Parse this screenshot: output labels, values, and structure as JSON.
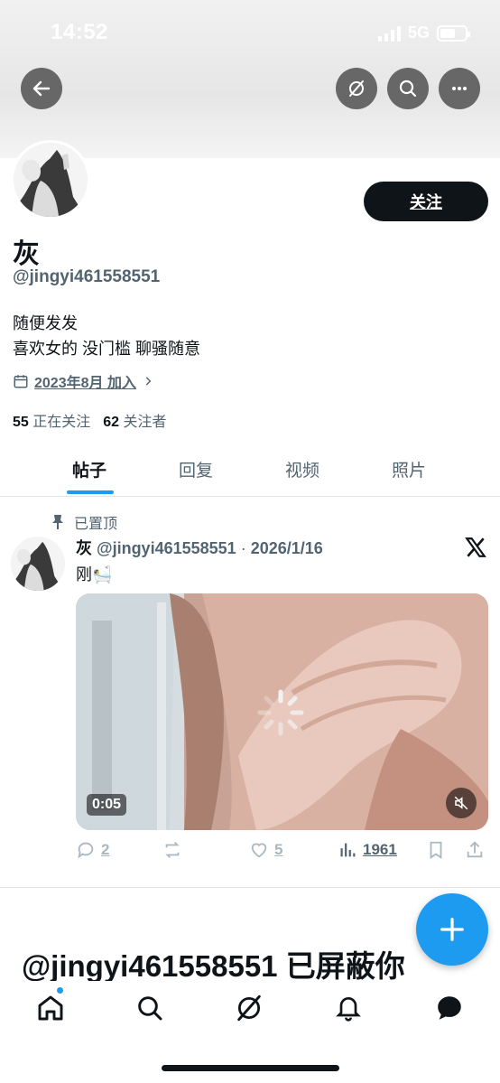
{
  "status_bar": {
    "time": "14:52",
    "network": "5G"
  },
  "header": {
    "icons": [
      "back-arrow-icon",
      "grok-icon",
      "search-icon",
      "more-icon"
    ]
  },
  "profile": {
    "display_name": "灰",
    "handle": "@jingyi461558551",
    "follow_label": "关注",
    "bio_lines": [
      "随便发发",
      "喜欢女的 没门槛 聊骚随意"
    ],
    "joined": "2023年8月 加入",
    "following_count": "55",
    "following_label": "正在关注",
    "followers_count": "62",
    "followers_label": "关注者"
  },
  "tabs": [
    {
      "label": "帖子",
      "active": true
    },
    {
      "label": "回复",
      "active": false
    },
    {
      "label": "视频",
      "active": false
    },
    {
      "label": "照片",
      "active": false
    }
  ],
  "post": {
    "pinned_label": "已置顶",
    "author_name": "灰",
    "author_handle": "@jingyi461558551",
    "separator": "·",
    "date": "2026/1/16",
    "text": "刚🛀",
    "video_duration": "0:05",
    "replies": "2",
    "likes": "5",
    "views": "1961"
  },
  "blocked_notice": "@jingyi461558551 已屏蔽你",
  "bottom_nav": {
    "icons": [
      "home-icon",
      "search-icon",
      "grok-icon",
      "notifications-icon",
      "messages-icon"
    ]
  },
  "colors": {
    "accent": "#1d9bf0",
    "text": "#0f1419",
    "secondary": "#536471"
  }
}
